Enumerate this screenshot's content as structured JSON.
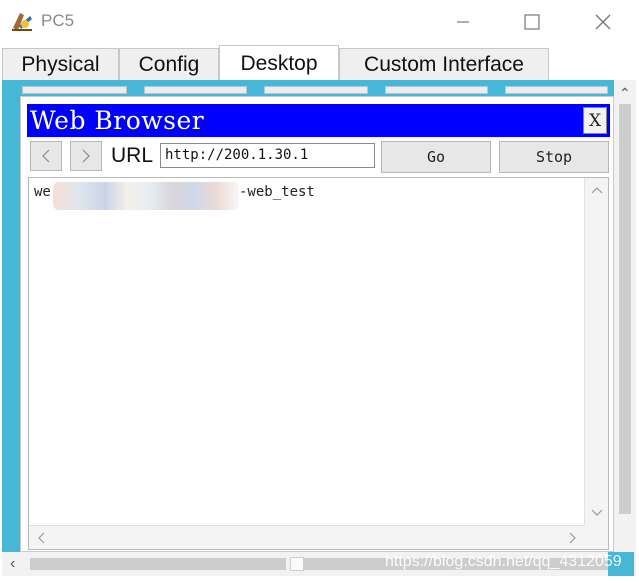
{
  "window": {
    "title": "PC5"
  },
  "tabs": [
    {
      "label": "Physical",
      "active": false
    },
    {
      "label": "Config",
      "active": false
    },
    {
      "label": "Desktop",
      "active": true
    },
    {
      "label": "Custom Interface",
      "active": false
    }
  ],
  "browser": {
    "title": "Web Browser",
    "close_label": "X",
    "url_label": "URL",
    "url_value": "http://200.1.30.1",
    "go_label": "Go",
    "stop_label": "Stop",
    "page_text_start": "we",
    "page_text_end": "-web_test",
    "title_bar_color": "#0000ff"
  },
  "desktop": {
    "background_color": "#46b7d6"
  },
  "watermark": "https://blog.csdn.net/qq_4312059"
}
